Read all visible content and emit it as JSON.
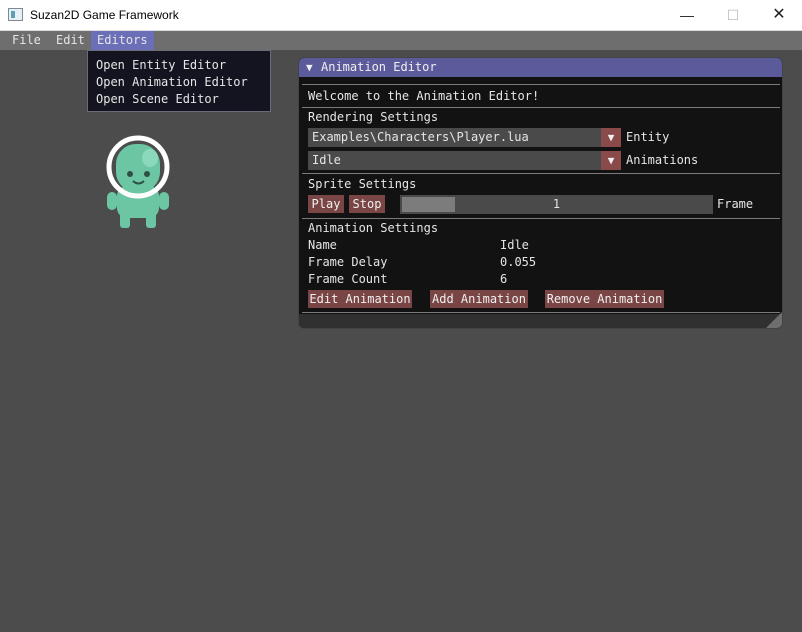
{
  "window": {
    "title": "Suzan2D Game Framework",
    "minimize_icon": "—",
    "maximize_icon": "☐",
    "close_icon": "✕"
  },
  "menubar": {
    "file": "File",
    "edit": "Edit",
    "editors": "Editors",
    "accent_color": "#6b6fb8"
  },
  "editors_menu": {
    "items": [
      "Open Entity Editor",
      "Open Animation Editor",
      "Open Scene Editor"
    ]
  },
  "animation_editor": {
    "title": "Animation Editor",
    "collapse_icon": "▼",
    "welcome": "Welcome to the Animation Editor!",
    "rendering": {
      "header": "Rendering Settings",
      "entity_value": "Examples\\Characters\\Player.lua",
      "entity_label": "Entity",
      "animation_value": "Idle",
      "animation_label": "Animations",
      "combo_arrow_icon": "▼"
    },
    "sprite": {
      "header": "Sprite Settings",
      "play": "Play",
      "stop": "Stop",
      "frame_value": "1",
      "frame_fraction": 0.17,
      "frame_label": "Frame"
    },
    "animation": {
      "header": "Animation Settings",
      "rows": [
        {
          "label": "Name",
          "value": "Idle"
        },
        {
          "label": "Frame Delay",
          "value": "0.055"
        },
        {
          "label": "Frame Count",
          "value": "6"
        }
      ],
      "edit": "Edit Animation",
      "add": "Add Animation",
      "remove": "Remove Animation"
    }
  }
}
